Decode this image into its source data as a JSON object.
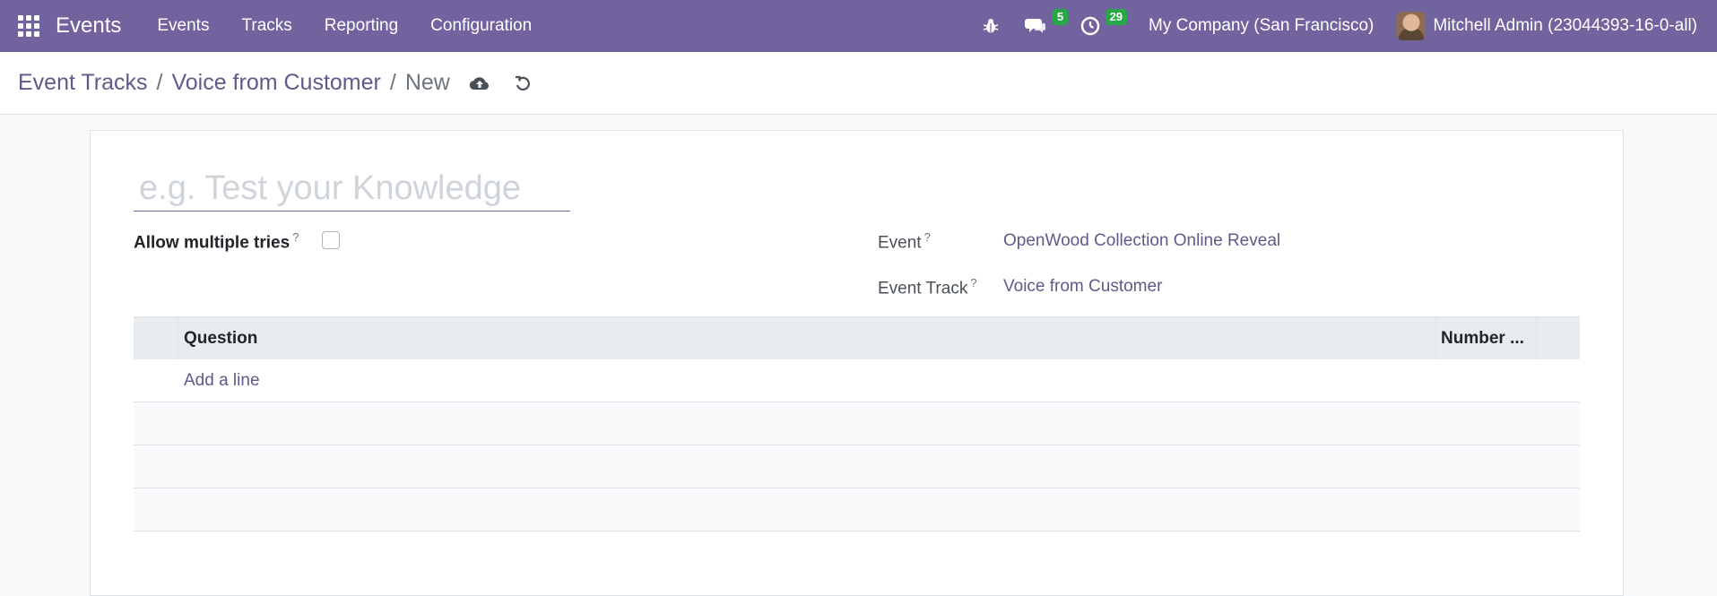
{
  "navbar": {
    "app_name": "Events",
    "menu": [
      "Events",
      "Tracks",
      "Reporting",
      "Configuration"
    ],
    "messages_count": "5",
    "activities_count": "29",
    "company": "My Company (San Francisco)",
    "user": "Mitchell Admin (23044393-16-0-all)"
  },
  "breadcrumb": {
    "items": [
      "Event Tracks",
      "Voice from Customer"
    ],
    "current": "New",
    "separator": "/"
  },
  "form": {
    "title_placeholder": "e.g. Test your Knowledge",
    "allow_multiple_tries_label": "Allow multiple tries",
    "help_mark": "?",
    "event_label": "Event",
    "event_value": "OpenWood Collection Online Reveal",
    "event_track_label": "Event Track",
    "event_track_value": "Voice from Customer",
    "allow_multiple_tries_checked": false
  },
  "questions_table": {
    "columns": [
      "Question",
      "Number ..."
    ],
    "add_line_label": "Add a line"
  },
  "colors": {
    "navbar": "#71639e",
    "link": "#5f5a8a",
    "badge": "#28a745"
  }
}
